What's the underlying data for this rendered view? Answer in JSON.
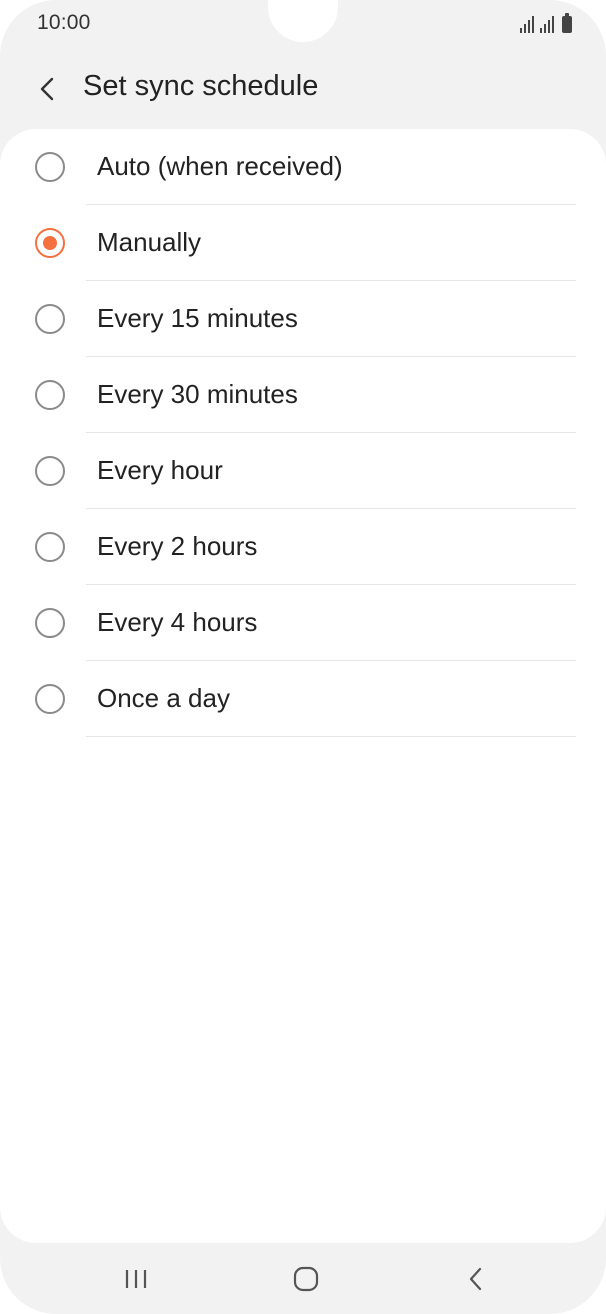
{
  "status_bar": {
    "time": "10:00",
    "icons": [
      "signal-icon",
      "signal-icon",
      "battery-icon"
    ]
  },
  "header": {
    "back_icon": "chevron-left-icon",
    "title": "Set sync schedule"
  },
  "options": [
    {
      "label": "Auto (when received)",
      "selected": false
    },
    {
      "label": "Manually",
      "selected": true
    },
    {
      "label": "Every 15 minutes",
      "selected": false
    },
    {
      "label": "Every 30 minutes",
      "selected": false
    },
    {
      "label": "Every hour",
      "selected": false
    },
    {
      "label": "Every 2 hours",
      "selected": false
    },
    {
      "label": "Every 4 hours",
      "selected": false
    },
    {
      "label": "Once a day",
      "selected": false
    }
  ],
  "nav_bar": {
    "recents_icon": "recents-icon",
    "home_icon": "home-icon",
    "back_icon": "back-icon"
  },
  "colors": {
    "accent": "#f4703f",
    "background": "#f2f2f2",
    "card": "#ffffff"
  }
}
